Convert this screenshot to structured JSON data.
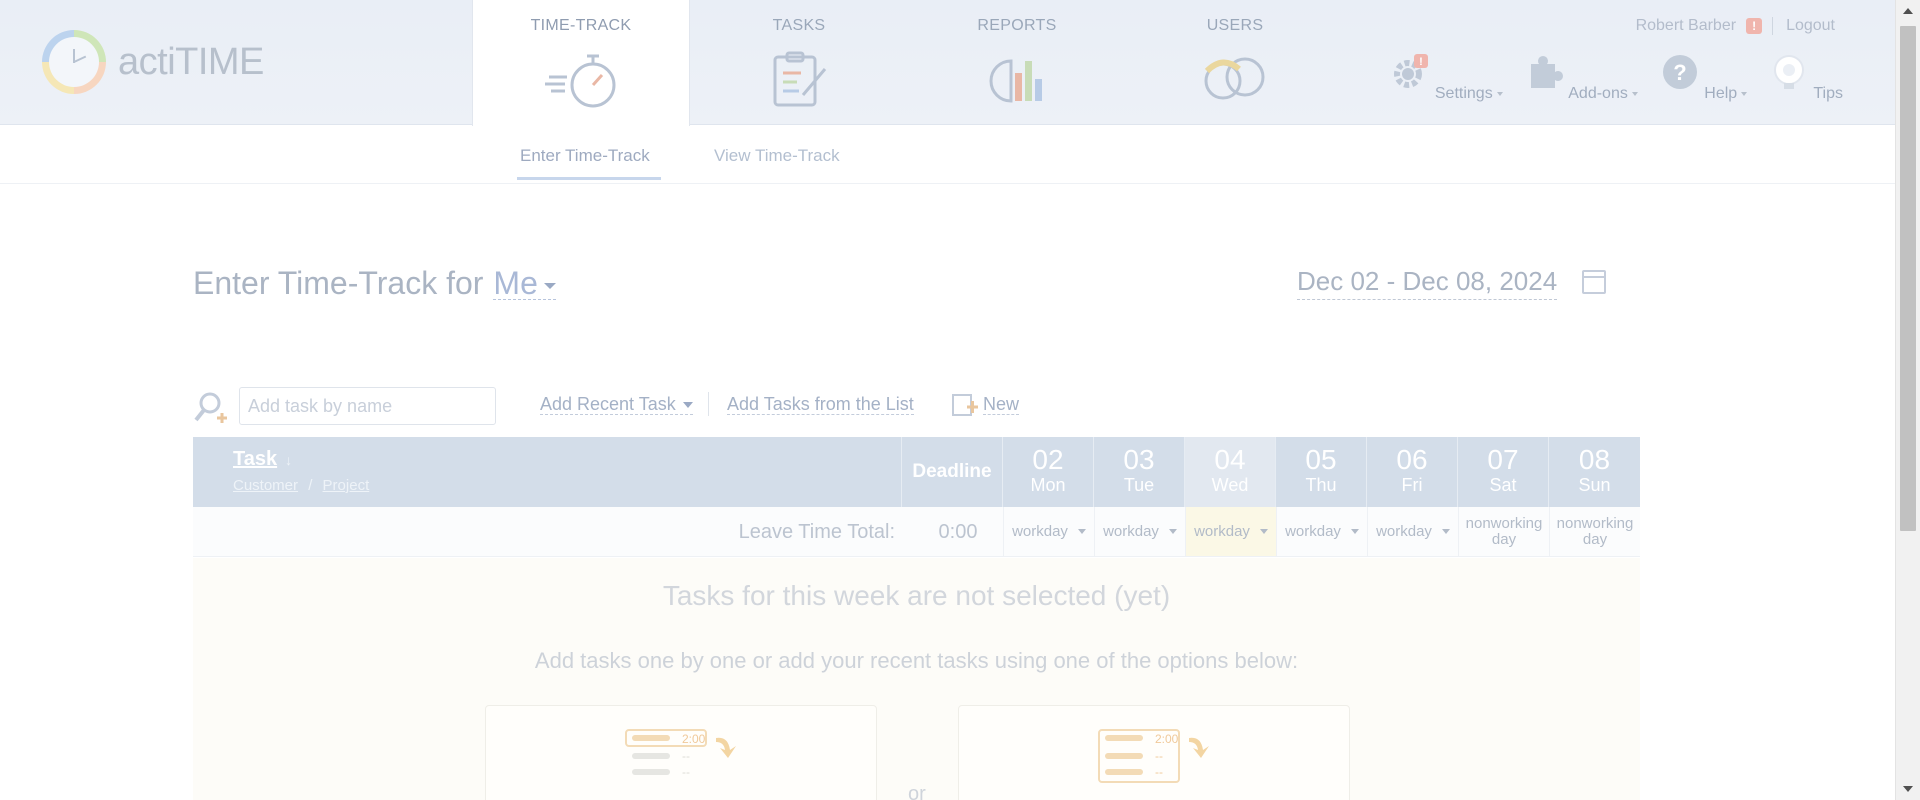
{
  "app": {
    "logo_text": "actiTIME"
  },
  "nav": {
    "tabs": [
      {
        "label": "TIME-TRACK",
        "icon": "stopwatch-icon",
        "active": true
      },
      {
        "label": "TASKS",
        "icon": "clipboard-icon",
        "active": false
      },
      {
        "label": "REPORTS",
        "icon": "chart-icon",
        "active": false
      },
      {
        "label": "USERS",
        "icon": "users-icon",
        "active": false
      }
    ]
  },
  "user": {
    "name": "Robert Barber",
    "alert_badge": "!",
    "logout_label": "Logout"
  },
  "tools": {
    "settings_label": "Settings",
    "settings_badge": "!",
    "addons_label": "Add-ons",
    "help_label": "Help",
    "tips_label": "Tips"
  },
  "subnav": {
    "enter_label": "Enter Time-Track",
    "view_label": "View Time-Track"
  },
  "headline": {
    "prefix": "Enter Time-Track for",
    "user_selector": "Me",
    "date_range": "Dec 02 - Dec 08, 2024"
  },
  "task_tools": {
    "search_placeholder": "Add task by name",
    "add_recent_label": "Add Recent Task",
    "add_from_list_label": "Add Tasks from the List",
    "new_label": "New"
  },
  "grid": {
    "task_header": "Task",
    "customer_label": "Customer",
    "slash": "/",
    "project_label": "Project",
    "deadline_header": "Deadline",
    "days": [
      {
        "num": "02",
        "dow": "Mon",
        "status": "workday",
        "today": false
      },
      {
        "num": "03",
        "dow": "Tue",
        "status": "workday",
        "today": false
      },
      {
        "num": "04",
        "dow": "Wed",
        "status": "workday",
        "today": true
      },
      {
        "num": "05",
        "dow": "Thu",
        "status": "workday",
        "today": false
      },
      {
        "num": "06",
        "dow": "Fri",
        "status": "workday",
        "today": false
      },
      {
        "num": "07",
        "dow": "Sat",
        "status_line1": "nonworking",
        "status_line2": "day",
        "today": false
      },
      {
        "num": "08",
        "dow": "Sun",
        "status_line1": "nonworking",
        "status_line2": "day",
        "today": false
      }
    ],
    "leave_label": "Leave Time Total:",
    "leave_total": "0:00"
  },
  "empty_state": {
    "title": "Tasks for this week are not selected (yet)",
    "subtitle": "Add tasks one by one or add your recent tasks using one of the options below:",
    "or_label": "or",
    "sample_value": "2:00",
    "sample_dash": "--"
  },
  "colors": {
    "header_bg": "#e9eef6",
    "grid_header_bg": "#d3dde9",
    "today_row_bg": "#fbf8e6",
    "link": "#a4b1c6"
  }
}
